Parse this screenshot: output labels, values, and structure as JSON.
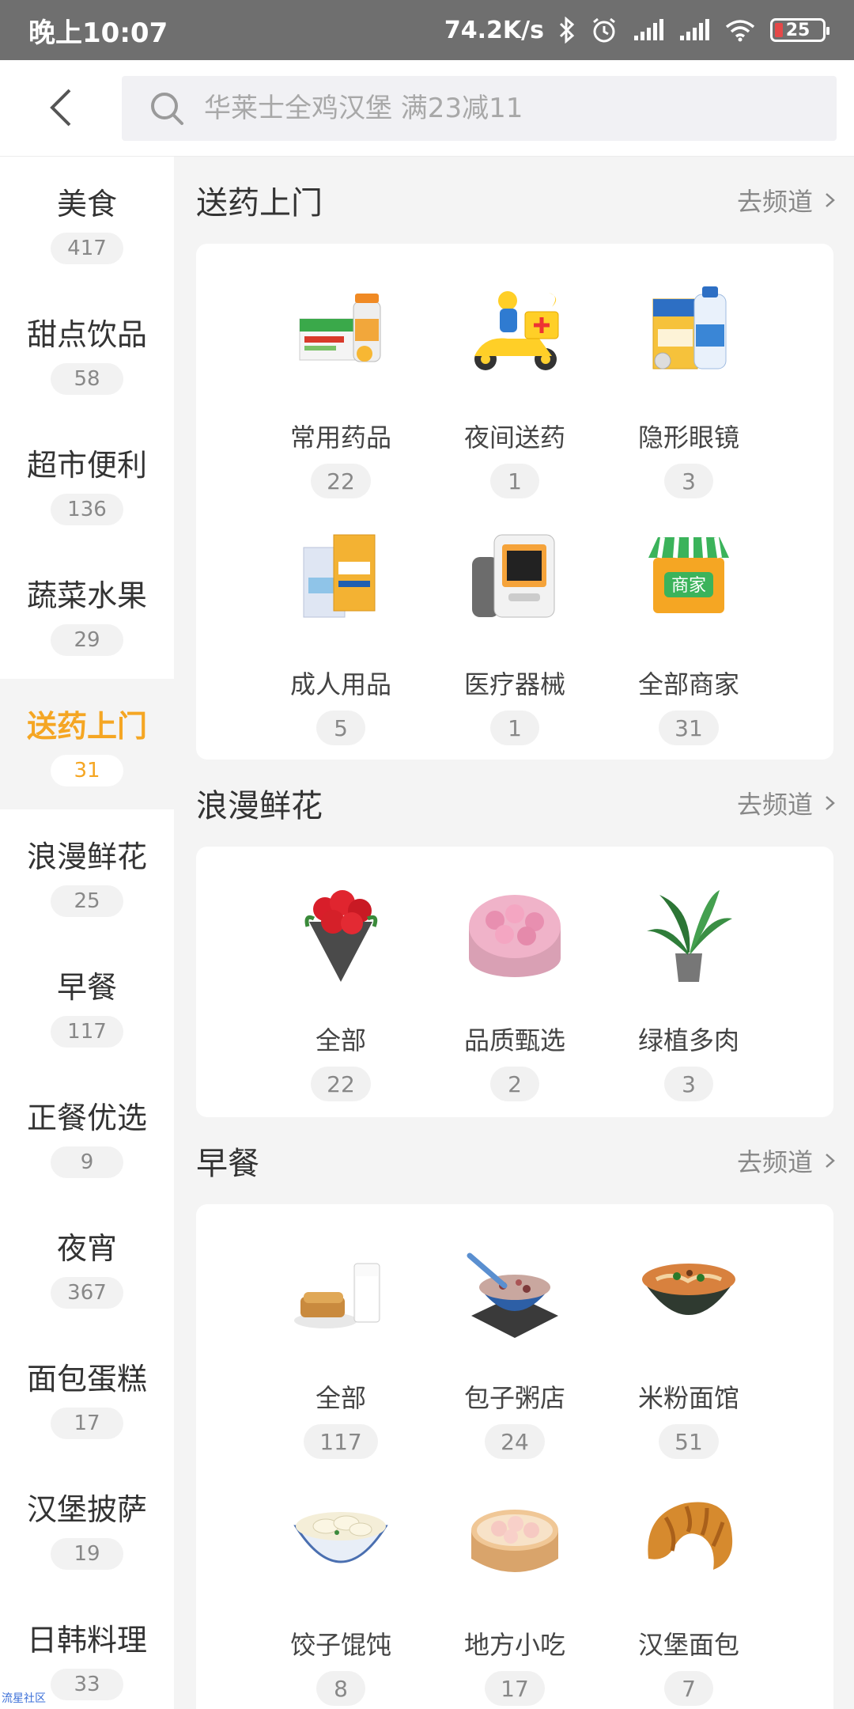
{
  "status_bar": {
    "time": "晚上10:07",
    "network_speed": "74.2K/s",
    "battery": "25",
    "icons": [
      "bluetooth-icon",
      "alarm-icon",
      "signal-icon",
      "signal-icon",
      "wifi-icon",
      "battery-icon"
    ]
  },
  "search": {
    "placeholder": "华莱士全鸡汉堡 满23减11"
  },
  "sidebar": {
    "active_color": "#f5a623",
    "items": [
      {
        "label": "美食",
        "count": "417"
      },
      {
        "label": "甜点饮品",
        "count": "58"
      },
      {
        "label": "超市便利",
        "count": "136"
      },
      {
        "label": "蔬菜水果",
        "count": "29"
      },
      {
        "label": "送药上门",
        "count": "31",
        "active": true
      },
      {
        "label": "浪漫鲜花",
        "count": "25"
      },
      {
        "label": "早餐",
        "count": "117"
      },
      {
        "label": "正餐优选",
        "count": "9"
      },
      {
        "label": "夜宵",
        "count": "367"
      },
      {
        "label": "面包蛋糕",
        "count": "17"
      },
      {
        "label": "汉堡披萨",
        "count": "19"
      },
      {
        "label": "日韩料理",
        "count": "33"
      }
    ]
  },
  "sections": [
    {
      "title": "送药上门",
      "link": "去频道",
      "items": [
        {
          "name": "常用药品",
          "count": "22",
          "icon": "medicine-box-icon"
        },
        {
          "name": "夜间送药",
          "count": "1",
          "icon": "delivery-scooter-icon"
        },
        {
          "name": "隐形眼镜",
          "count": "3",
          "icon": "contact-lens-solution-icon"
        },
        {
          "name": "成人用品",
          "count": "5",
          "icon": "adult-products-icon"
        },
        {
          "name": "医疗器械",
          "count": "1",
          "icon": "blood-pressure-monitor-icon"
        },
        {
          "name": "全部商家",
          "count": "31",
          "icon": "store-icon"
        }
      ],
      "store_badge": "商家"
    },
    {
      "title": "浪漫鲜花",
      "link": "去频道",
      "items": [
        {
          "name": "全部",
          "count": "22",
          "icon": "rose-bouquet-icon"
        },
        {
          "name": "品质甄选",
          "count": "2",
          "icon": "flower-box-icon"
        },
        {
          "name": "绿植多肉",
          "count": "3",
          "icon": "potted-plant-icon"
        }
      ]
    },
    {
      "title": "早餐",
      "link": "去频道",
      "items": [
        {
          "name": "全部",
          "count": "117",
          "icon": "bread-milk-icon"
        },
        {
          "name": "包子粥店",
          "count": "24",
          "icon": "congee-bowl-icon"
        },
        {
          "name": "米粉面馆",
          "count": "51",
          "icon": "noodle-bowl-icon"
        },
        {
          "name": "饺子馄饨",
          "count": "8",
          "icon": "dumpling-bowl-icon"
        },
        {
          "name": "地方小吃",
          "count": "17",
          "icon": "steamer-snack-icon"
        },
        {
          "name": "汉堡面包",
          "count": "7",
          "icon": "croissant-icon"
        }
      ]
    }
  ],
  "watermark": "流星社区"
}
